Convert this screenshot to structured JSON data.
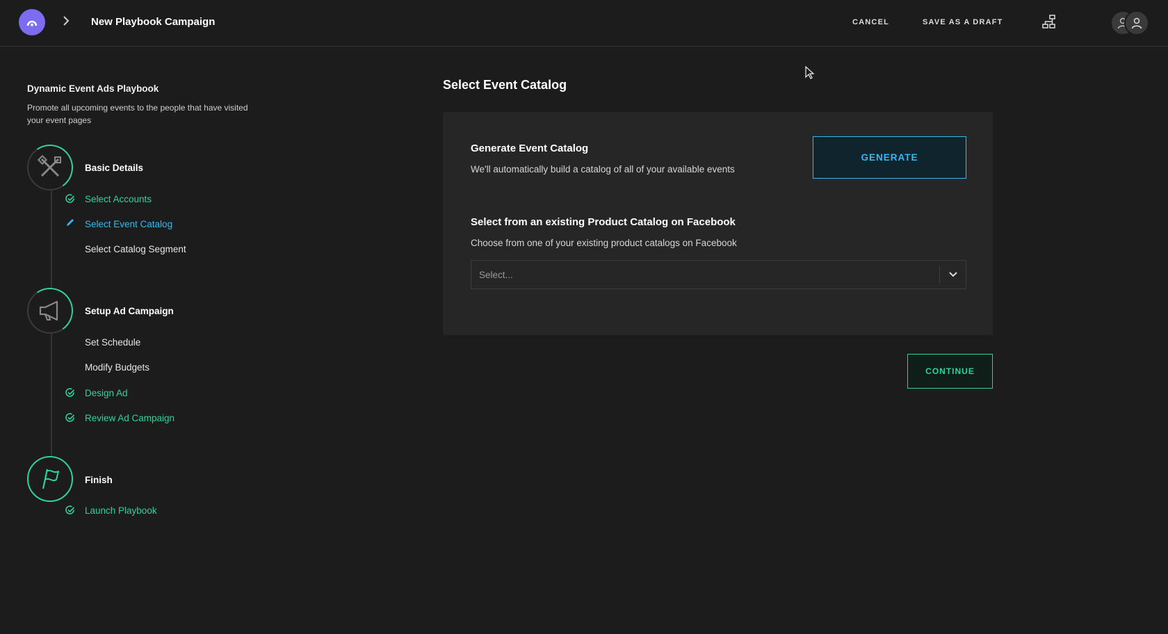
{
  "header": {
    "title": "New Playbook Campaign",
    "cancel_label": "CANCEL",
    "save_draft_label": "SAVE AS A DRAFT"
  },
  "sidebar": {
    "playbook_title": "Dynamic Event Ads Playbook",
    "playbook_description": "Promote all upcoming events to the people that have visited your event pages",
    "stages": [
      {
        "title": "Basic Details",
        "icon": "tools-icon",
        "steps": [
          {
            "label": "Select Accounts",
            "status": "done"
          },
          {
            "label": "Select Event Catalog",
            "status": "active"
          },
          {
            "label": "Select Catalog Segment",
            "status": "pending"
          }
        ]
      },
      {
        "title": "Setup Ad Campaign",
        "icon": "megaphone-icon",
        "steps": [
          {
            "label": "Set Schedule",
            "status": "pending"
          },
          {
            "label": "Modify Budgets",
            "status": "pending"
          },
          {
            "label": "Design Ad",
            "status": "done"
          },
          {
            "label": "Review Ad Campaign",
            "status": "done"
          }
        ]
      },
      {
        "title": "Finish",
        "icon": "flag-icon",
        "steps": [
          {
            "label": "Launch Playbook",
            "status": "done"
          }
        ]
      }
    ]
  },
  "main": {
    "title": "Select Event Catalog",
    "generate_section": {
      "title": "Generate Event Catalog",
      "description": "We'll automatically build a catalog of all of your available events",
      "button_label": "GENERATE"
    },
    "existing_section": {
      "title": "Select from an existing Product Catalog on Facebook",
      "description": "Choose from one of your existing product catalogs on Facebook",
      "select_placeholder": "Select..."
    },
    "continue_label": "CONTINUE"
  },
  "colors": {
    "background": "#1c1c1c",
    "panel": "#262626",
    "accent_green": "#2ed39a",
    "accent_blue": "#35b8f0",
    "logo": "#7b6cf0"
  }
}
